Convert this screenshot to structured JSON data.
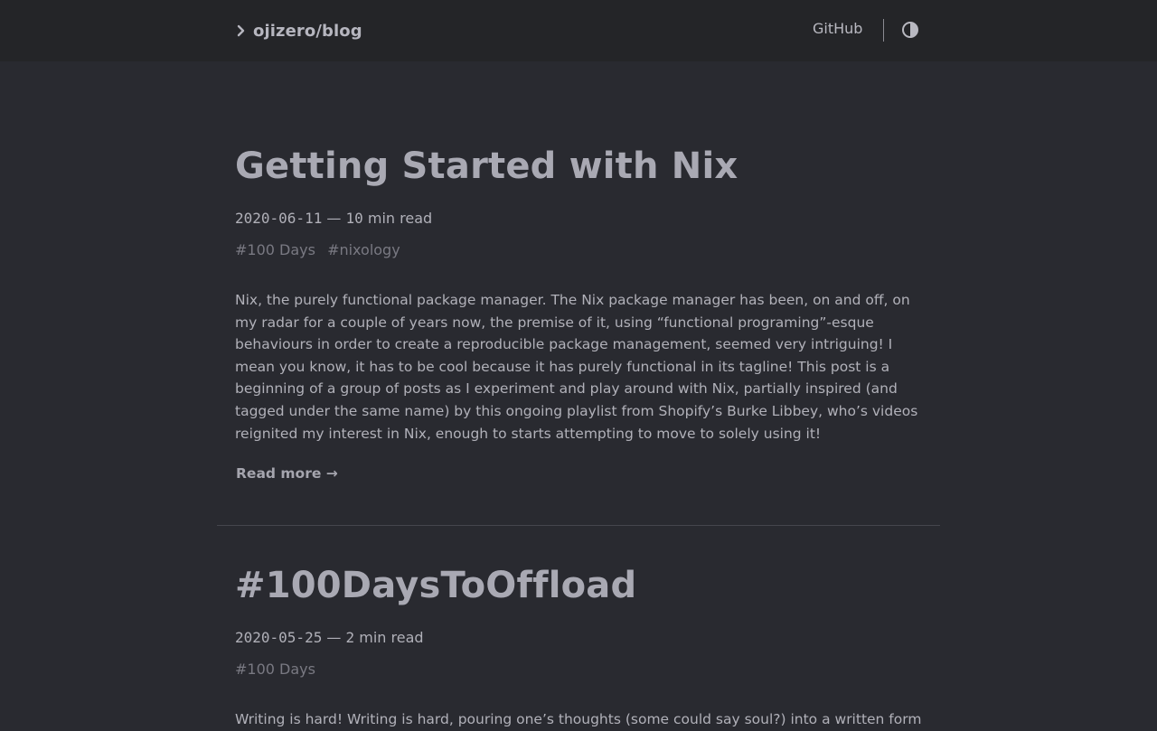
{
  "header": {
    "brand": "ojizero/blog",
    "nav_github": "GitHub"
  },
  "icons": {
    "brand": "chevron-right-icon",
    "theme_toggle": "contrast-icon"
  },
  "colors": {
    "background": "#292a30",
    "header_background": "#242528",
    "title": "#a9a9b3",
    "text": "#b1b1b9",
    "tag": "#797982"
  },
  "posts": [
    {
      "title": "Getting Started with Nix",
      "date": "2020-06-11",
      "separator": "—",
      "read_time_number": "10",
      "read_time_unit": "min read",
      "tags": [
        "#100 Days",
        "#nixology"
      ],
      "excerpt": "Nix, the purely functional package manager. The Nix package manager has been, on and off, on my radar for a couple of years now, the premise of it, using “functional programing”-esque behaviours in order to create a reproducible package management, seemed very intriguing! I mean you know, it has to be cool because it has purely functional in its tagline! This post is a beginning of a group of posts as I experiment and play around with Nix, partially inspired (and tagged under the same name) by this ongoing playlist from Shopify’s Burke Libbey, who’s videos reignited my interest in Nix, enough to starts attempting to move to solely using it!",
      "read_more": "Read more →"
    },
    {
      "title": "#100DaysToOffload",
      "date": "2020-05-25",
      "separator": "—",
      "read_time_number": "2",
      "read_time_unit": "min read",
      "tags": [
        "#100 Days"
      ],
      "excerpt": "Writing is hard! Writing is hard, pouring one’s thoughts (some could say soul?) into a written form"
    }
  ]
}
